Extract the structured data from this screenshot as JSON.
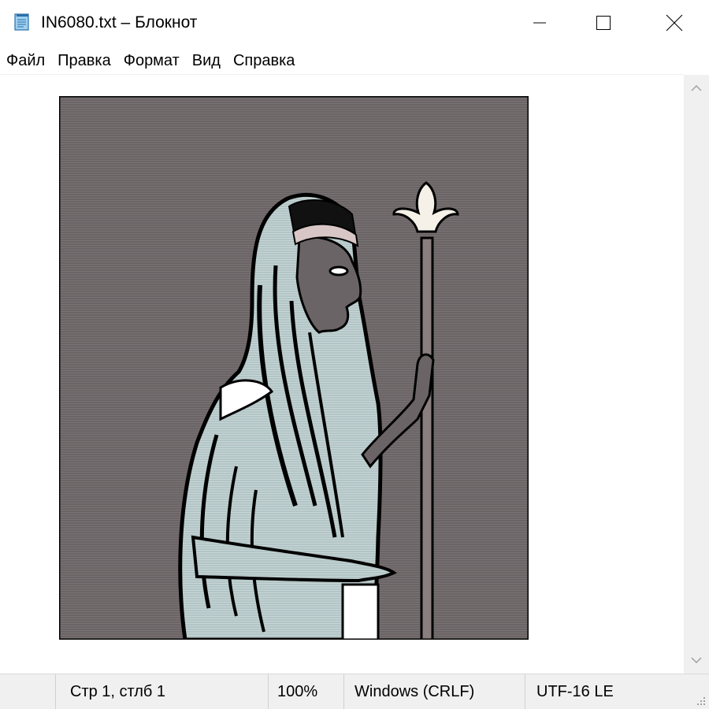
{
  "window": {
    "title": "IN6080.txt – Блокнот",
    "icon": "notepad-icon",
    "controls": [
      "minimize-icon",
      "maximize-icon",
      "close-icon"
    ]
  },
  "menu": {
    "items": [
      "Файл",
      "Правка",
      "Формат",
      "Вид",
      "Справка"
    ]
  },
  "editor": {
    "content_picture": "ascii-art-greek-woman-with-lily-staff",
    "colors": {
      "background": "#6b6466",
      "garment": "#b8c8c8",
      "outline": "#000000",
      "skin": "#6b6466",
      "white": "#ffffff"
    }
  },
  "status": {
    "position": "Стр 1, стлб 1",
    "zoom": "100%",
    "line_endings": "Windows (CRLF)",
    "encoding": "UTF-16 LE"
  }
}
